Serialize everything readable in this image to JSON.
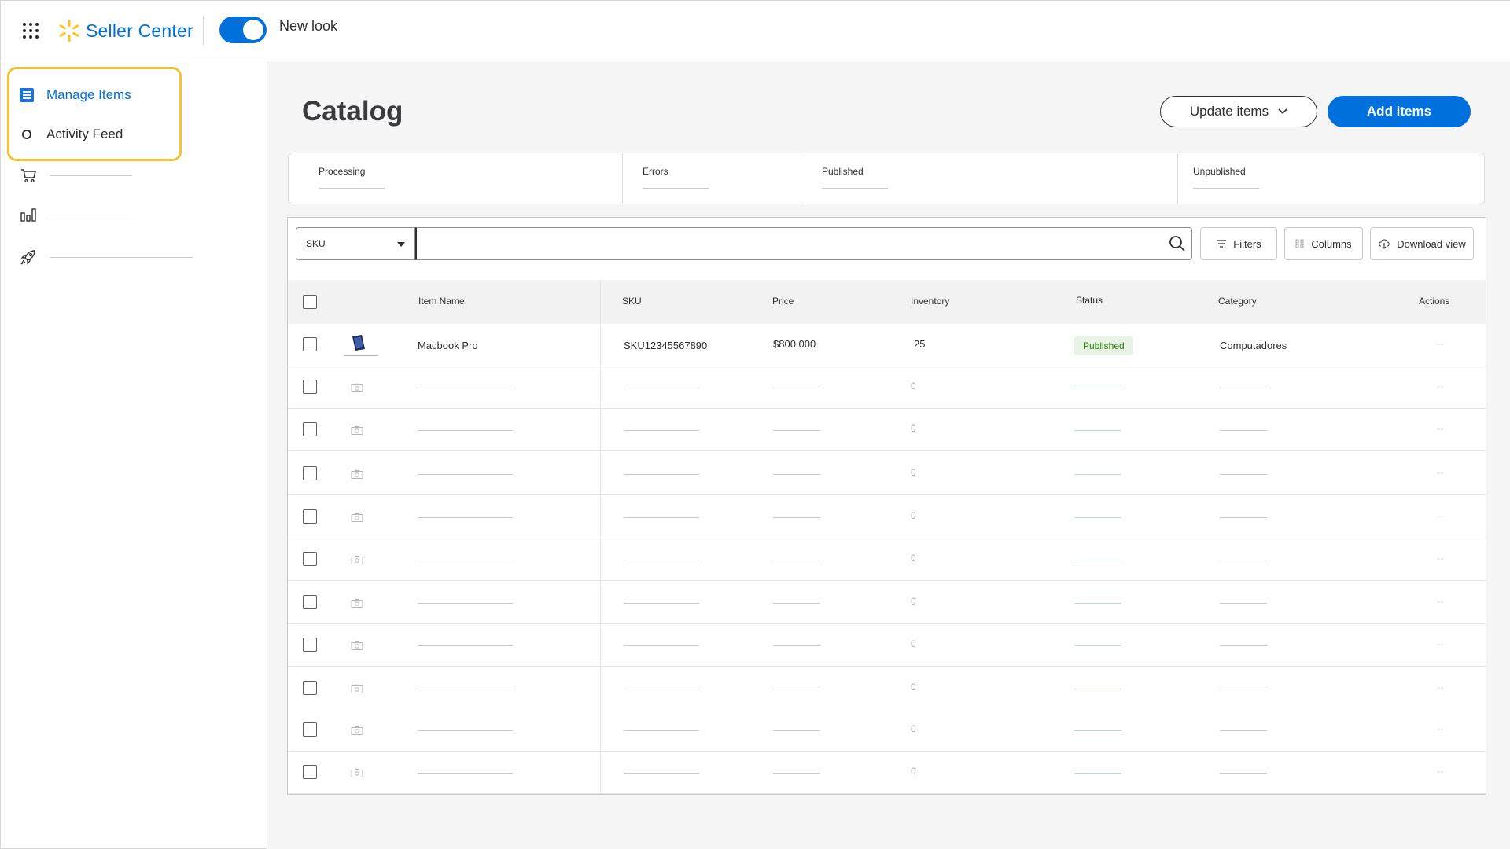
{
  "header": {
    "brand": "Seller Center",
    "toggle_label": "New look",
    "toggle_on": true
  },
  "sidebar": {
    "items": [
      {
        "label": "Manage Items",
        "icon": "list-icon",
        "active": true
      },
      {
        "label": "Activity Feed",
        "icon": "ring-icon",
        "active": false
      }
    ],
    "icons": [
      "cart-icon",
      "bar-chart-icon",
      "rocket-icon"
    ]
  },
  "main": {
    "title": "Catalog",
    "update_button": "Update items",
    "add_button": "Add items",
    "stats": [
      {
        "label": "Processing"
      },
      {
        "label": "Errors"
      },
      {
        "label": "Published"
      },
      {
        "label": "Unpublished"
      }
    ],
    "search": {
      "selected_field": "SKU",
      "placeholder": ""
    },
    "tools": {
      "filters": "Filters",
      "columns": "Columns",
      "download": "Download view"
    },
    "table": {
      "columns": [
        "Item Name",
        "SKU",
        "Price",
        "Inventory",
        "Status",
        "Category",
        "Actions"
      ],
      "first_row": {
        "name": "Macbook Pro",
        "sku": "SKU12345567890",
        "price": "$800.000",
        "inventory": "25",
        "status": "Published",
        "category": "Computadores",
        "actions": "--"
      },
      "placeholder_rows": [
        {
          "inventory": "0",
          "actions": "--",
          "status_color": "green"
        },
        {
          "inventory": "0",
          "actions": "--",
          "status_color": "green"
        },
        {
          "inventory": "0",
          "actions": "--",
          "status_color": "green"
        },
        {
          "inventory": "0",
          "actions": "--",
          "status_color": "green"
        },
        {
          "inventory": "0",
          "actions": "--",
          "status_color": "green"
        },
        {
          "inventory": "0",
          "actions": "--",
          "status_color": "green"
        },
        {
          "inventory": "0",
          "actions": "--",
          "status_color": "green"
        },
        {
          "inventory": "0",
          "actions": "--",
          "status_color": "red"
        },
        {
          "inventory": "0",
          "actions": "--",
          "status_color": "green"
        },
        {
          "inventory": "0",
          "actions": "--",
          "status_color": "green"
        }
      ]
    }
  },
  "colors": {
    "brand_blue": "#0071dc",
    "brand_yellow": "#ffc220",
    "highlight": "#f6c13a",
    "published_green": "#2a8703"
  }
}
